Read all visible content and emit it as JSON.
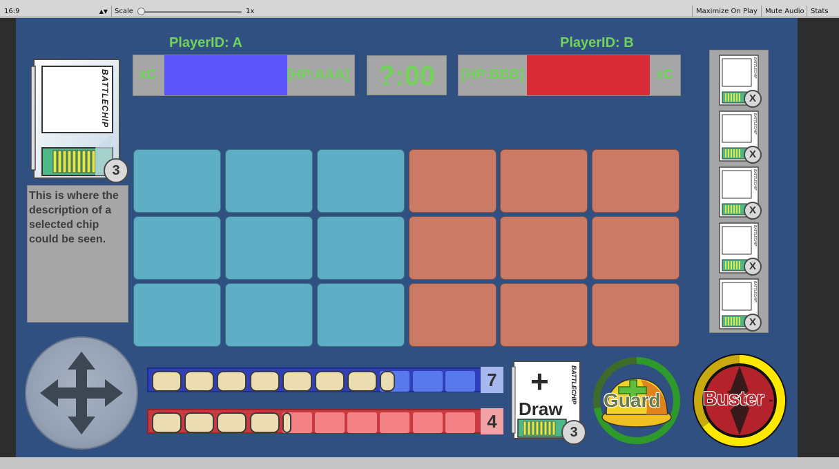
{
  "toolbar": {
    "aspect": "16:9",
    "scale_label": "Scale",
    "scale_value": "1x",
    "maximize_label": "Maximize On Play",
    "mute_label": "Mute Audio",
    "stats_label": "Stats"
  },
  "player_a": {
    "id_label": "PlayerID: A",
    "xc": "xC",
    "hp": "[HP:AAA]",
    "hp_fraction": 1.0,
    "color": "#5d55fa"
  },
  "player_b": {
    "id_label": "PlayerID: B",
    "xc": "xC",
    "hp": "[HP:BBB]",
    "hp_fraction": 1.0,
    "color": "#d92b37"
  },
  "timer": "?:00",
  "selected_chip": {
    "brand": "BATTLECHIP",
    "count": "3",
    "description": "This is where the description of a selected chip could be seen."
  },
  "chip_queue": [
    {
      "remove": "X",
      "brand": "BATTLECHIP"
    },
    {
      "remove": "X",
      "brand": "BATTLECHIP"
    },
    {
      "remove": "X",
      "brand": "BATTLECHIP"
    },
    {
      "remove": "X",
      "brand": "BATTLECHIP"
    },
    {
      "remove": "X",
      "brand": "BATTLECHIP"
    }
  ],
  "grid": {
    "rows": 3,
    "cols": 6,
    "player_color": "#5eafc6",
    "enemy_color": "#cb7b65"
  },
  "custom_gauge": {
    "count": "7",
    "filled": 7.5,
    "total": 10
  },
  "enemy_gauge": {
    "count": "4",
    "filled": 4.3,
    "total": 10
  },
  "draw": {
    "plus": "+",
    "label": "Draw",
    "count": "3",
    "brand": "BATTLECHIP"
  },
  "guard": {
    "label": "Guard",
    "charge": 0.72
  },
  "buster": {
    "label": "Buster",
    "charge": 0.65
  }
}
